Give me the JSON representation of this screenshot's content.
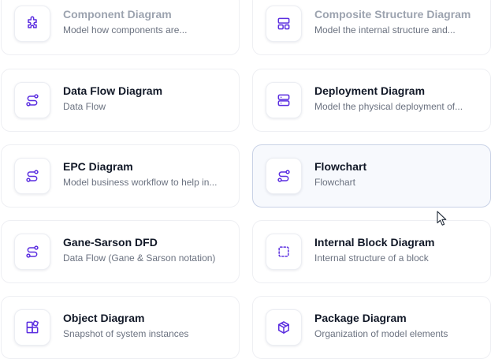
{
  "cards": [
    {
      "title": "Component Diagram",
      "description": "Model how components are...",
      "icon": "puzzle-icon"
    },
    {
      "title": "Composite Structure Diagram",
      "description": "Model the internal structure and...",
      "icon": "layout-blocks-icon"
    },
    {
      "title": "Data Flow Diagram",
      "description": "Data Flow",
      "icon": "flow-route-icon"
    },
    {
      "title": "Deployment Diagram",
      "description": "Model the physical deployment of...",
      "icon": "server-icon"
    },
    {
      "title": "EPC Diagram",
      "description": "Model business workflow to help in...",
      "icon": "flow-route-icon"
    },
    {
      "title": "Flowchart",
      "description": "Flowchart",
      "icon": "flow-route-icon"
    },
    {
      "title": "Gane-Sarson DFD",
      "description": "Data Flow (Gane & Sarson notation)",
      "icon": "flow-route-icon"
    },
    {
      "title": "Internal Block Diagram",
      "description": "Internal structure of a block",
      "icon": "dashed-square-icon"
    },
    {
      "title": "Object Diagram",
      "description": "Snapshot of system instances",
      "icon": "shapes-icon"
    },
    {
      "title": "Package Diagram",
      "description": "Organization of model elements",
      "icon": "package-box-icon"
    }
  ],
  "selected_card": "Flowchart",
  "colors": {
    "accent": "#5b2ee0",
    "title": "#111827",
    "description": "#6b7280",
    "selected_background": "#f7f9fd",
    "selected_border": "#c9d2e6"
  }
}
